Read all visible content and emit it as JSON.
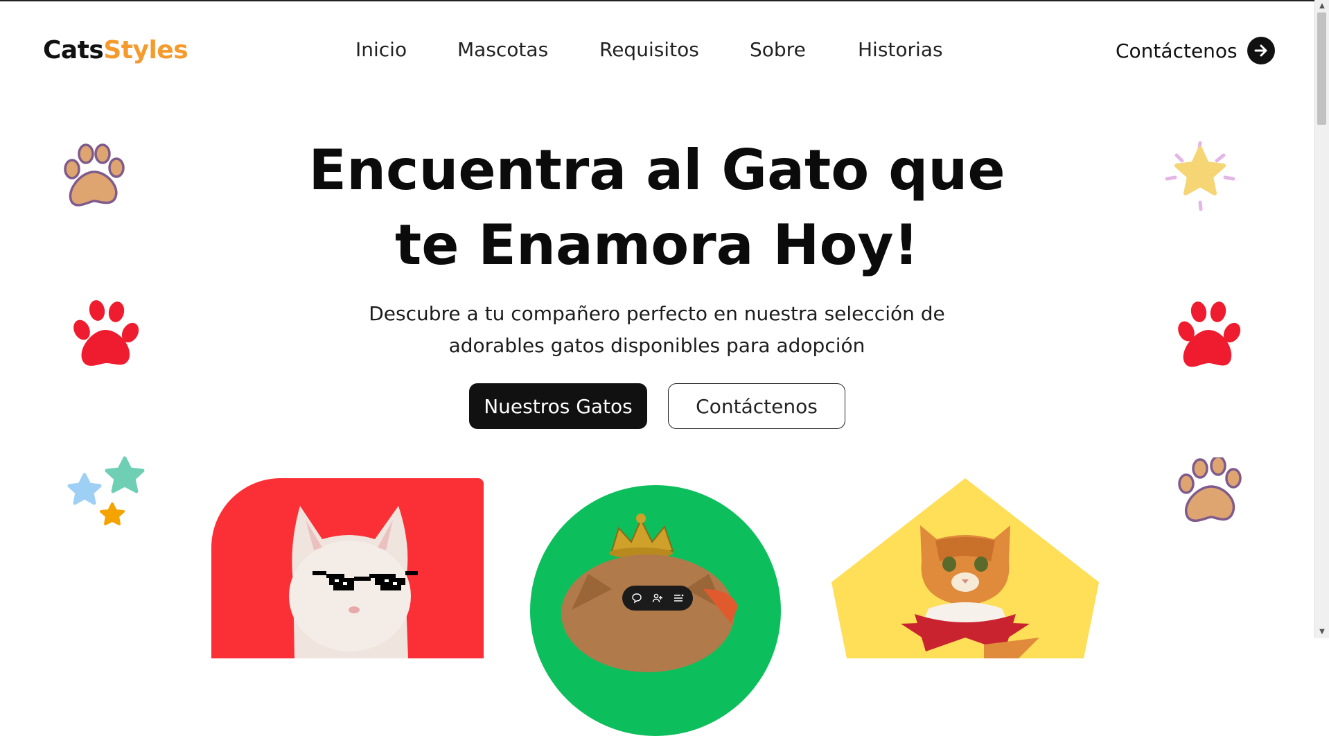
{
  "brand": {
    "part1": "Cats",
    "part2": "Styles",
    "accent": "#f59a2c"
  },
  "nav": {
    "items": [
      "Inicio",
      "Mascotas",
      "Requisitos",
      "Sobre",
      "Historias"
    ]
  },
  "header_cta": {
    "label": "Contáctenos",
    "icon": "arrow-right-icon"
  },
  "hero": {
    "title_line1": "Encuentra al Gato que",
    "title_line2": "te Enamora Hoy!",
    "subtitle": "Descubre a tu compañero perfecto en nuestra selección de adorables gatos disponibles para adopción",
    "primary_button": "Nuestros Gatos",
    "secondary_button": "Contáctenos"
  },
  "decorations": [
    "paw-print-icon",
    "star-icon",
    "paw-print-icon",
    "paw-print-icon",
    "stars-icon",
    "paw-print-icon"
  ],
  "cards": [
    {
      "shape": "rounded-square",
      "color": "#fb3036",
      "subject": "cat-with-sunglasses"
    },
    {
      "shape": "circle",
      "color": "#0dbf5c",
      "subject": "cat-with-crown"
    },
    {
      "shape": "pentagon",
      "color": "#ffdf57",
      "subject": "cat-with-bandana"
    }
  ],
  "floating_toolbar": {
    "icons": [
      "comment-icon",
      "add-user-icon",
      "list-icon"
    ]
  },
  "colors": {
    "red": "#fb3036",
    "green": "#0dbf5c",
    "yellow": "#ffdf57",
    "paw_orange": "#dea570",
    "paw_red": "#ee1c2e"
  }
}
